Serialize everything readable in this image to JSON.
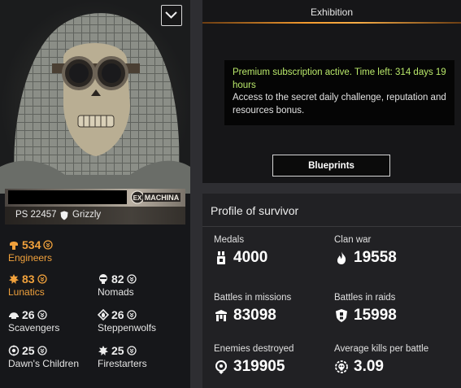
{
  "header": {
    "tab_title": "Exhibition"
  },
  "player": {
    "ps_label": "PS 22457",
    "nickname": "Grizzly",
    "banner_logo_text": "MACHINA"
  },
  "factions": [
    {
      "value": "534",
      "name": "Engineers",
      "icon": "engineers-icon",
      "highlight": true
    },
    {
      "value": "83",
      "name": "Lunatics",
      "icon": "lunatics-icon",
      "highlight": true
    },
    {
      "value": "82",
      "name": "Nomads",
      "icon": "nomads-icon",
      "highlight": false
    },
    {
      "value": "26",
      "name": "Scavengers",
      "icon": "scavengers-icon",
      "highlight": false
    },
    {
      "value": "26",
      "name": "Steppenwolfs",
      "icon": "steppenwolfs-icon",
      "highlight": false
    },
    {
      "value": "25",
      "name": "Dawn's Children",
      "icon": "dawns-children-icon",
      "highlight": false
    },
    {
      "value": "25",
      "name": "Firestarters",
      "icon": "firestarters-icon",
      "highlight": false
    }
  ],
  "premium": {
    "status": "Premium subscription active. Time left: 314 days 19 hours",
    "description": "Access to the secret daily challenge, reputation and resources bonus."
  },
  "blueprints_button": "Blueprints",
  "profile": {
    "title": "Profile of survivor",
    "stats": [
      {
        "label": "Medals",
        "value": "4000",
        "icon": "medal-icon"
      },
      {
        "label": "Clan war",
        "value": "19558",
        "icon": "flame-icon"
      },
      {
        "label": "Battles in missions",
        "value": "83098",
        "icon": "missions-icon"
      },
      {
        "label": "Battles in raids",
        "value": "15998",
        "icon": "raids-shield-icon"
      },
      {
        "label": "Enemies destroyed",
        "value": "319905",
        "icon": "target-icon"
      },
      {
        "label": "Average kills per battle",
        "value": "3.09",
        "icon": "skull-gear-icon"
      }
    ]
  },
  "colors": {
    "accent_orange": "#f0a13c",
    "premium_green": "#b9e86a",
    "panel_dark": "#161618",
    "panel_grey": "#212124"
  }
}
